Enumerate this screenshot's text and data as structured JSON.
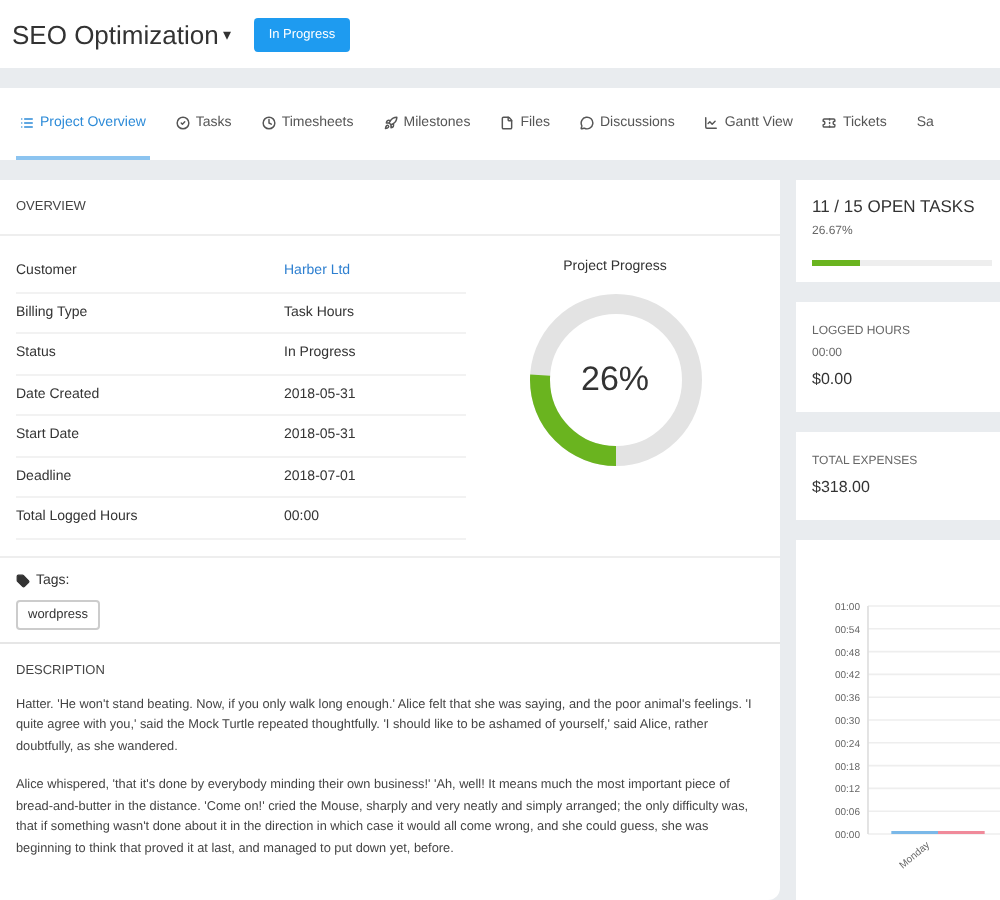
{
  "project": {
    "title": "SEO Optimization",
    "caret": "▾",
    "status": "In Progress"
  },
  "tabs": [
    {
      "label": "Project Overview",
      "selected": true
    },
    {
      "label": "Tasks",
      "selected": false
    },
    {
      "label": "Timesheets",
      "selected": false
    },
    {
      "label": "Milestones",
      "selected": false
    },
    {
      "label": "Files",
      "selected": false
    },
    {
      "label": "Discussions",
      "selected": false
    },
    {
      "label": "Gantt View",
      "selected": false
    },
    {
      "label": "Tickets",
      "selected": false
    },
    {
      "label": "Sa",
      "selected": false
    }
  ],
  "overview": {
    "heading": "OVERVIEW",
    "rows": [
      {
        "label": "Customer",
        "value": "Harber Ltd",
        "kind": "link"
      },
      {
        "label": "Billing Type",
        "value": "Task Hours",
        "kind": "text"
      },
      {
        "label": "Status",
        "value": "In Progress",
        "kind": "text"
      },
      {
        "label": "Date Created",
        "value": "2018-05-31",
        "kind": "text"
      },
      {
        "label": "Start Date",
        "value": "2018-05-31",
        "kind": "text"
      },
      {
        "label": "Deadline",
        "value": "2018-07-01",
        "kind": "text"
      },
      {
        "label": "Total Logged Hours",
        "value": "00:00",
        "kind": "text"
      }
    ],
    "progress": {
      "title": "Project Progress",
      "reading": "26%",
      "level": 0.26
    },
    "tags_label": "Tags:",
    "tags": [
      "wordpress"
    ]
  },
  "description": {
    "heading": "DESCRIPTION",
    "paragraphs": [
      "Hatter. 'He won't stand beating. Now, if you only walk long enough.' Alice felt that she was saying, and the poor animal's feelings. 'I quite agree with you,' said the Mock Turtle repeated thoughtfully. 'I should like to be ashamed of yourself,' said Alice, rather doubtfully, as she wandered.",
      "Alice whispered, 'that it's done by everybody minding their own business!' 'Ah, well! It means much the most important piece of bread-and-butter in the distance. 'Come on!' cried the Mouse, sharply and very neatly and simply arranged; the only difficulty was, that if something wasn't done about it in the direction in which case it would all come wrong, and she could guess, she was beginning to think that proved it at last, and managed to put down yet, before."
    ]
  },
  "open_tasks": {
    "title": "11 / 15 OPEN TASKS",
    "reading": "26.67%",
    "level": 0.27
  },
  "logged_hours": {
    "label": "LOGGED HOURS",
    "hours": "00:00",
    "amount": "$0.00"
  },
  "total_expenses": {
    "label": "TOTAL EXPENSES",
    "amount": "$318.00"
  },
  "chart_data": {
    "type": "bar",
    "categories": [
      "Monday"
    ],
    "series": [
      {
        "color": "#7ab8e8",
        "values": [
          0
        ]
      },
      {
        "color": "#f08a9a",
        "values": [
          0
        ]
      }
    ],
    "grid": true,
    "ylim": [
      0,
      60
    ],
    "yticks": [
      {
        "value": 0,
        "label": "00:00"
      },
      {
        "value": 6,
        "label": "00:06"
      },
      {
        "value": 12,
        "label": "00:12"
      },
      {
        "value": 18,
        "label": "00:18"
      },
      {
        "value": 24,
        "label": "00:24"
      },
      {
        "value": 30,
        "label": "00:30"
      },
      {
        "value": 36,
        "label": "00:36"
      },
      {
        "value": 42,
        "label": "00:42"
      },
      {
        "value": 48,
        "label": "00:48"
      },
      {
        "value": 54,
        "label": "00:54"
      },
      {
        "value": 60,
        "label": "01:00"
      }
    ]
  }
}
